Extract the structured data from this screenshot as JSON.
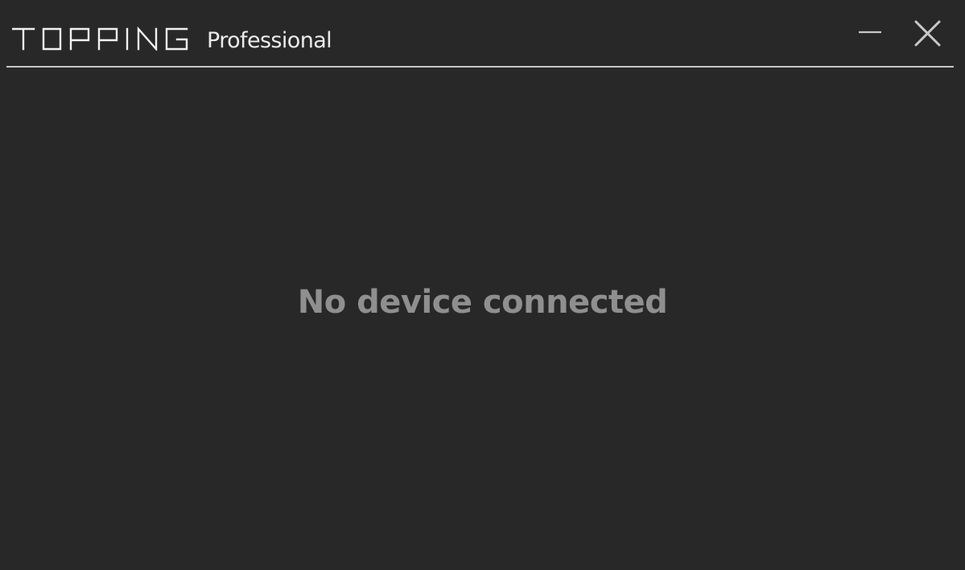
{
  "window": {
    "logo_text": "TOPPING",
    "product_name": "Professional",
    "controls": {
      "minimize_icon": "minimize-icon",
      "close_icon": "close-icon"
    }
  },
  "main": {
    "status_text": "No device connected"
  },
  "colors": {
    "background": "#282828",
    "title_text": "#ececec",
    "divider": "#c6c6c6",
    "status_text": "#8f8f8f",
    "window_controls": "#c8c8c8"
  }
}
